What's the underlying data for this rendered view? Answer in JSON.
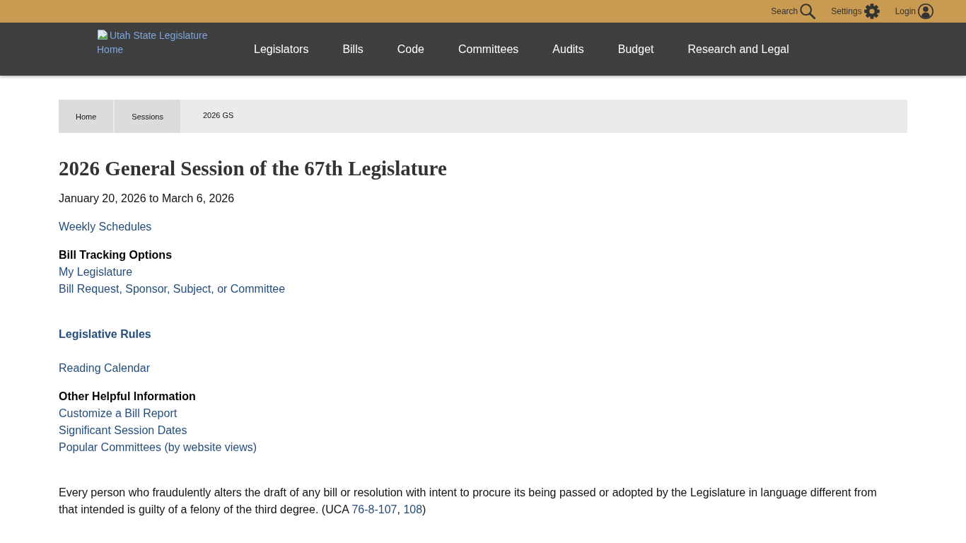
{
  "top_bar": {
    "links": [
      {
        "kind": "search",
        "label": "Search"
      },
      {
        "kind": "settings",
        "label": "Settings"
      },
      {
        "kind": "login",
        "label": "Login"
      }
    ]
  },
  "header": {
    "logo": {
      "alt_text": "Utah State Legislature Home"
    },
    "nav": [
      "Legislators",
      "Bills",
      "Code",
      "Committees",
      "Audits",
      "Budget",
      "Research and Legal"
    ]
  },
  "breadcrumb": [
    {
      "label": "Home",
      "current": false
    },
    {
      "label": "Sessions",
      "current": false
    },
    {
      "label": "2026 GS",
      "current": true
    }
  ],
  "page": {
    "title": "2026 General Session of the 67th Legislature",
    "dates": "January 20, 2026 to March 6, 2026",
    "blocks": [
      {
        "kind": "link",
        "text": "Weekly Schedules"
      },
      {
        "kind": "group",
        "heading": "Bill Tracking Options",
        "links": [
          "My Legislature",
          "Bill Request, Sponsor, Subject, or Committee"
        ]
      },
      {
        "kind": "heading_link",
        "text": "Legislative Rules"
      },
      {
        "kind": "link",
        "text": "Reading Calendar"
      },
      {
        "kind": "group",
        "heading": "Other Helpful Information",
        "links": [
          "Customize a Bill Report",
          "Significant Session Dates",
          "Popular Committees (by website views)"
        ]
      }
    ],
    "notice": [
      {
        "kind": "text",
        "text": "Every person who fraudulently alters the draft of any bill or resolution with intent to procure its being passed or adopted by the Legislature in language different from that intended is guilty of a felony of the third degree. (UCA "
      },
      {
        "kind": "link",
        "text": "76-8-107"
      },
      {
        "kind": "text",
        "text": ", "
      },
      {
        "kind": "link",
        "text": "108"
      },
      {
        "kind": "text",
        "text": ")"
      }
    ]
  }
}
